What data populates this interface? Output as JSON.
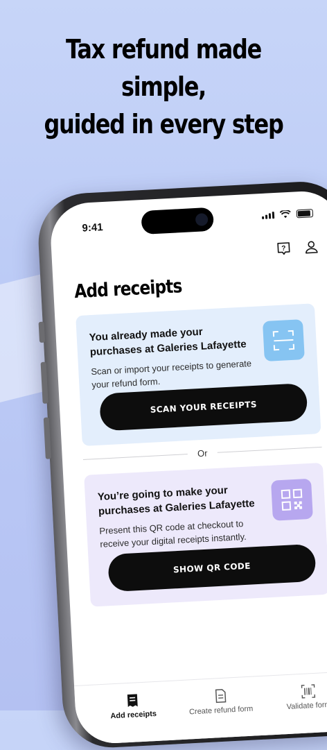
{
  "headline": {
    "line1": "Tax refund made simple,",
    "line2": "guided in every step"
  },
  "status_bar": {
    "time": "9:41"
  },
  "screen": {
    "title": "Add receipts",
    "cards": [
      {
        "title": "You already made your purchases at Galeries Lafayette",
        "description": "Scan or import your receipts to generate your refund form.",
        "button": "SCAN YOUR RECEIPTS",
        "icon": "scan-icon",
        "color": "#86c4f2"
      },
      {
        "title": "You’re going to make your purchases at Galeries Lafayette",
        "description": "Present this QR code at checkout to receive your digital receipts instantly.",
        "button": "SHOW QR CODE",
        "icon": "qr-code-icon",
        "color": "#b7a7ef"
      }
    ],
    "divider_label": "Or"
  },
  "tabs": [
    {
      "label": "Add receipts",
      "icon": "receipt-icon",
      "active": true
    },
    {
      "label": "Create refund form",
      "icon": "document-icon",
      "active": false
    },
    {
      "label": "Validate form",
      "icon": "barcode-icon",
      "active": false
    }
  ]
}
